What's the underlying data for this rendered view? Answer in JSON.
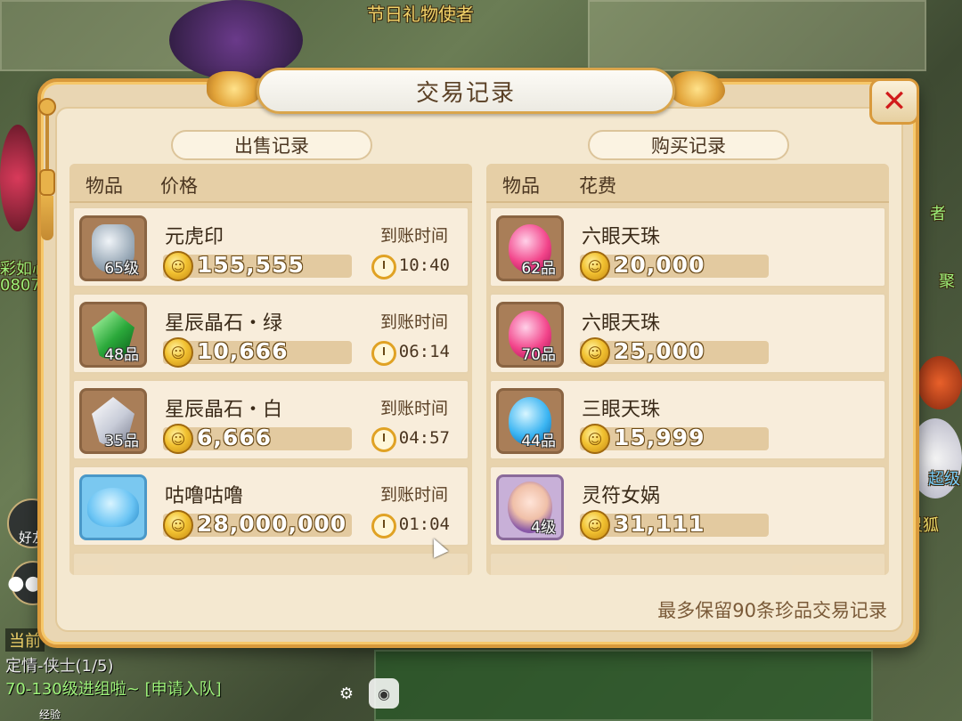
{
  "background": {
    "npc_title": "节日礼物使者",
    "left_name_1": "彩如心",
    "left_name_2": "0807",
    "right_name_1": "聚",
    "right_name_2": "超级",
    "right_name_3": "灵狐",
    "right_name_4": "者",
    "friends_label": "好友",
    "chat_tab": "当前",
    "chat_line_1": "定情-侠士(1/5)",
    "chat_line_2": "70-130级进组啦~ [申请入队]",
    "exp_label": "经验"
  },
  "dialog": {
    "title": "交易记录",
    "close_icon": "close-icon",
    "footer_note": "最多保留90条珍品交易记录"
  },
  "sell_panel": {
    "title": "出售记录",
    "col_item": "物品",
    "col_price": "价格",
    "arrival_label": "到账时间",
    "rows": [
      {
        "name": "元虎印",
        "level": "65级",
        "price": "155,555",
        "time": "10:40",
        "icon": "tiger-seal-icon"
      },
      {
        "name": "星辰晶石・绿",
        "level": "48品",
        "price": "10,666",
        "time": "06:14",
        "icon": "green-crystal-icon"
      },
      {
        "name": "星辰晶石・白",
        "level": "35品",
        "price": "6,666",
        "time": "04:57",
        "icon": "white-crystal-icon"
      },
      {
        "name": "咕噜咕噜",
        "level": "",
        "price": "28,000,000",
        "time": "01:04",
        "icon": "blue-pet-icon"
      }
    ]
  },
  "buy_panel": {
    "title": "购买记录",
    "col_item": "物品",
    "col_cost": "花费",
    "rows": [
      {
        "name": "六眼天珠",
        "level": "62品",
        "price": "20,000",
        "icon": "pink-bead-icon"
      },
      {
        "name": "六眼天珠",
        "level": "70品",
        "price": "25,000",
        "icon": "pink-bead-icon"
      },
      {
        "name": "三眼天珠",
        "level": "44品",
        "price": "15,999",
        "icon": "blue-bead-icon"
      },
      {
        "name": "灵符女娲",
        "level": "4级",
        "price": "31,111",
        "icon": "nuwa-icon"
      }
    ]
  },
  "colors": {
    "frame": "#d99a3c",
    "panel_bg": "#f4e8d0",
    "close_x": "#d11b1b",
    "coin": "#f2c232"
  }
}
